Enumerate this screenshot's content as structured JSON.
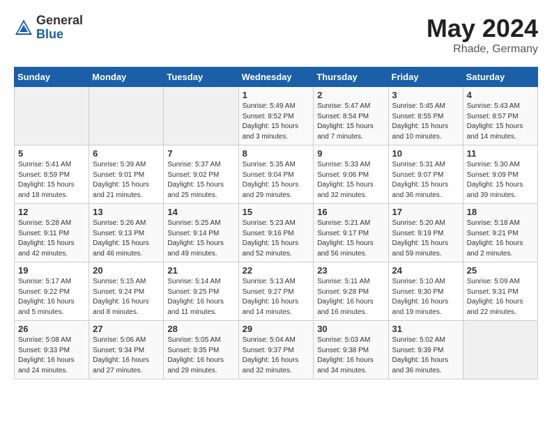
{
  "header": {
    "logo_general": "General",
    "logo_blue": "Blue",
    "month_year": "May 2024",
    "location": "Rhade, Germany"
  },
  "days_of_week": [
    "Sunday",
    "Monday",
    "Tuesday",
    "Wednesday",
    "Thursday",
    "Friday",
    "Saturday"
  ],
  "weeks": [
    [
      {
        "num": "",
        "info": ""
      },
      {
        "num": "",
        "info": ""
      },
      {
        "num": "",
        "info": ""
      },
      {
        "num": "1",
        "info": "Sunrise: 5:49 AM\nSunset: 8:52 PM\nDaylight: 15 hours\nand 3 minutes."
      },
      {
        "num": "2",
        "info": "Sunrise: 5:47 AM\nSunset: 8:54 PM\nDaylight: 15 hours\nand 7 minutes."
      },
      {
        "num": "3",
        "info": "Sunrise: 5:45 AM\nSunset: 8:55 PM\nDaylight: 15 hours\nand 10 minutes."
      },
      {
        "num": "4",
        "info": "Sunrise: 5:43 AM\nSunset: 8:57 PM\nDaylight: 15 hours\nand 14 minutes."
      }
    ],
    [
      {
        "num": "5",
        "info": "Sunrise: 5:41 AM\nSunset: 8:59 PM\nDaylight: 15 hours\nand 18 minutes."
      },
      {
        "num": "6",
        "info": "Sunrise: 5:39 AM\nSunset: 9:01 PM\nDaylight: 15 hours\nand 21 minutes."
      },
      {
        "num": "7",
        "info": "Sunrise: 5:37 AM\nSunset: 9:02 PM\nDaylight: 15 hours\nand 25 minutes."
      },
      {
        "num": "8",
        "info": "Sunrise: 5:35 AM\nSunset: 9:04 PM\nDaylight: 15 hours\nand 29 minutes."
      },
      {
        "num": "9",
        "info": "Sunrise: 5:33 AM\nSunset: 9:06 PM\nDaylight: 15 hours\nand 32 minutes."
      },
      {
        "num": "10",
        "info": "Sunrise: 5:31 AM\nSunset: 9:07 PM\nDaylight: 15 hours\nand 36 minutes."
      },
      {
        "num": "11",
        "info": "Sunrise: 5:30 AM\nSunset: 9:09 PM\nDaylight: 15 hours\nand 39 minutes."
      }
    ],
    [
      {
        "num": "12",
        "info": "Sunrise: 5:28 AM\nSunset: 9:11 PM\nDaylight: 15 hours\nand 42 minutes."
      },
      {
        "num": "13",
        "info": "Sunrise: 5:26 AM\nSunset: 9:13 PM\nDaylight: 15 hours\nand 46 minutes."
      },
      {
        "num": "14",
        "info": "Sunrise: 5:25 AM\nSunset: 9:14 PM\nDaylight: 15 hours\nand 49 minutes."
      },
      {
        "num": "15",
        "info": "Sunrise: 5:23 AM\nSunset: 9:16 PM\nDaylight: 15 hours\nand 52 minutes."
      },
      {
        "num": "16",
        "info": "Sunrise: 5:21 AM\nSunset: 9:17 PM\nDaylight: 15 hours\nand 56 minutes."
      },
      {
        "num": "17",
        "info": "Sunrise: 5:20 AM\nSunset: 9:19 PM\nDaylight: 15 hours\nand 59 minutes."
      },
      {
        "num": "18",
        "info": "Sunrise: 5:18 AM\nSunset: 9:21 PM\nDaylight: 16 hours\nand 2 minutes."
      }
    ],
    [
      {
        "num": "19",
        "info": "Sunrise: 5:17 AM\nSunset: 9:22 PM\nDaylight: 16 hours\nand 5 minutes."
      },
      {
        "num": "20",
        "info": "Sunrise: 5:15 AM\nSunset: 9:24 PM\nDaylight: 16 hours\nand 8 minutes."
      },
      {
        "num": "21",
        "info": "Sunrise: 5:14 AM\nSunset: 9:25 PM\nDaylight: 16 hours\nand 11 minutes."
      },
      {
        "num": "22",
        "info": "Sunrise: 5:13 AM\nSunset: 9:27 PM\nDaylight: 16 hours\nand 14 minutes."
      },
      {
        "num": "23",
        "info": "Sunrise: 5:11 AM\nSunset: 9:28 PM\nDaylight: 16 hours\nand 16 minutes."
      },
      {
        "num": "24",
        "info": "Sunrise: 5:10 AM\nSunset: 9:30 PM\nDaylight: 16 hours\nand 19 minutes."
      },
      {
        "num": "25",
        "info": "Sunrise: 5:09 AM\nSunset: 9:31 PM\nDaylight: 16 hours\nand 22 minutes."
      }
    ],
    [
      {
        "num": "26",
        "info": "Sunrise: 5:08 AM\nSunset: 9:33 PM\nDaylight: 16 hours\nand 24 minutes."
      },
      {
        "num": "27",
        "info": "Sunrise: 5:06 AM\nSunset: 9:34 PM\nDaylight: 16 hours\nand 27 minutes."
      },
      {
        "num": "28",
        "info": "Sunrise: 5:05 AM\nSunset: 9:35 PM\nDaylight: 16 hours\nand 29 minutes."
      },
      {
        "num": "29",
        "info": "Sunrise: 5:04 AM\nSunset: 9:37 PM\nDaylight: 16 hours\nand 32 minutes."
      },
      {
        "num": "30",
        "info": "Sunrise: 5:03 AM\nSunset: 9:38 PM\nDaylight: 16 hours\nand 34 minutes."
      },
      {
        "num": "31",
        "info": "Sunrise: 5:02 AM\nSunset: 9:39 PM\nDaylight: 16 hours\nand 36 minutes."
      },
      {
        "num": "",
        "info": ""
      }
    ]
  ]
}
